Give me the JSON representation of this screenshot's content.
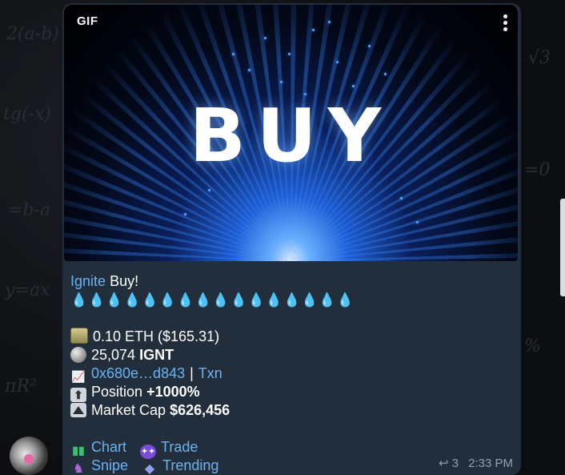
{
  "message": {
    "media": {
      "badge": "GIF",
      "headline": "BUY",
      "menu_icon": "more-vertical-icon"
    },
    "title": {
      "link": "Ignite",
      "rest": "Buy!"
    },
    "fire_row": "💧💧💧💧💧💧💧💧💧💧💧💧💧💧💧💧",
    "details": {
      "spent": "0.10 ETH ($165.31)",
      "received_amount": "25,074",
      "received_token": "IGNT",
      "buyer_link": "0x680e…d843",
      "separator": "|",
      "txn_link": "Txn",
      "position_label": "Position",
      "position_value": "+1000%",
      "marketcap_label": "Market Cap",
      "marketcap_value": "$626,456"
    },
    "buttons": {
      "chart": "Chart",
      "trade": "Trade",
      "snipe": "Snipe",
      "trending": "Trending"
    },
    "footer": {
      "reply_count": "3",
      "time": "2:33 PM"
    }
  },
  "colors": {
    "bubble": "#232e3c",
    "link": "#6ab3f3",
    "meta": "#8ea2b8"
  }
}
